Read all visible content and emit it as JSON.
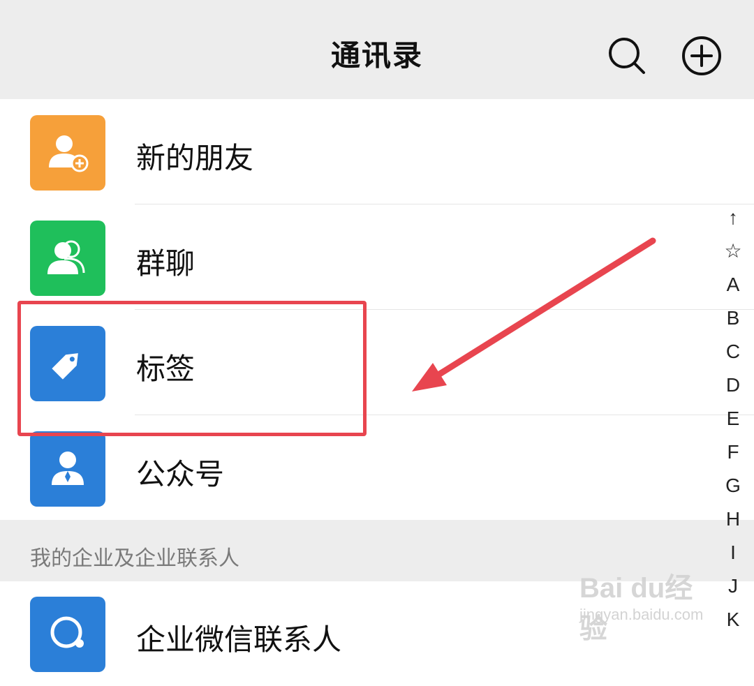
{
  "header": {
    "title": "通讯录",
    "search_icon": "search-icon",
    "add_icon": "plus-circle-icon"
  },
  "rows": [
    {
      "label": "新的朋友",
      "icon": "add-friend-icon",
      "color": "#f6a03a"
    },
    {
      "label": "群聊",
      "icon": "group-chat-icon",
      "color": "#1fbf5b"
    },
    {
      "label": "标签",
      "icon": "tag-icon",
      "color": "#2b7fd8"
    },
    {
      "label": "公众号",
      "icon": "official-account-icon",
      "color": "#2b7fd8"
    }
  ],
  "section": {
    "title": "我的企业及企业联系人"
  },
  "enterprise_row": {
    "label": "企业微信联系人",
    "icon": "work-contact-icon",
    "color": "#2b7fd8"
  },
  "index_letters": [
    "↑",
    "☆",
    "A",
    "B",
    "C",
    "D",
    "E",
    "F",
    "G",
    "H",
    "I",
    "J",
    "K"
  ],
  "annotation": {
    "box_color": "#e8454f",
    "arrow_color": "#e8454f"
  },
  "watermark": {
    "main": "Bai du经验",
    "sub": "jingyan.baidu.com"
  }
}
